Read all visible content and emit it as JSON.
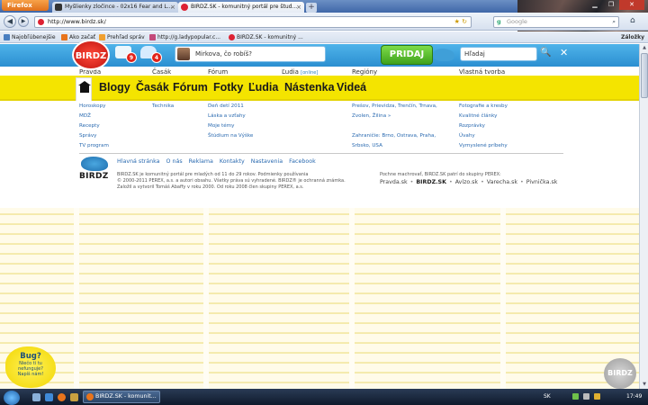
{
  "browser": {
    "app_button": "Firefox",
    "tabs": [
      {
        "label": "Myšlienky zločince - 02x16 Fear and L..."
      },
      {
        "label": "BIRDZ.SK - komunitný portál pre štud..."
      }
    ],
    "new_tab": "+",
    "url": "http://www.birdz.sk/",
    "search_placeholder": "Google",
    "bookmarks": [
      {
        "label": "Najobľúbenejšie"
      },
      {
        "label": "Ako začať"
      },
      {
        "label": "Prehľad správ"
      },
      {
        "label": "http://g.ladypopular.c..."
      },
      {
        "label": "BIRDZ.SK - komunitný ..."
      }
    ],
    "bookmarks_more": "Záložky"
  },
  "site": {
    "logo": "BIRDZ",
    "badges": {
      "messages": "9",
      "friends": "4"
    },
    "status_placeholder": "Mirkova, čo robíš?",
    "pridaj": "PRIDAJ",
    "search_placeholder": "Hľadaj",
    "sub_labels": [
      {
        "label": "Pravda"
      },
      {
        "label": "Časák"
      },
      {
        "label": "Fórum"
      },
      {
        "label": "Ľudia",
        "extra": "[online]"
      },
      {
        "label": "Regióny"
      },
      {
        "label": "Vlastná tvorba"
      }
    ],
    "nav": [
      "Blogy",
      "Časák",
      "Fórum",
      "Fotky",
      "Ľudia",
      "Nástenka",
      "Videá"
    ],
    "columns": {
      "col1": [
        "Horoskopy",
        "MDŽ",
        "Recepty",
        "Správy",
        "TV program"
      ],
      "col2": [
        "Technika"
      ],
      "col3": [
        "Deň detí 2011",
        "Láska a vzťahy",
        "Moje témy",
        "Štúdium na Výške"
      ],
      "col4": [
        "Prešov, Prievidza, Trenčín, Trnava,",
        "Zvolen, Žilina »",
        "",
        "Zahraničie: Brno, Ostrava, Praha,",
        "Srbsko, USA"
      ],
      "col5": [
        "Fotografie a kresby",
        "Kvalitné články",
        "Rozprávky",
        "Úvahy",
        "Vymyslené príbehy"
      ]
    },
    "footer": {
      "logo": "BIRDZ",
      "links": [
        "Hlavná stránka",
        "O nás",
        "Reklama",
        "Kontakty",
        "Nastavenia",
        "Facebook"
      ],
      "text1": "BIRDZ.SK je komunitný portál pre mladých od 11 do 29 rokov. Podmienky používania",
      "text2": "© 2000-2011 PEREX, a.s. a autori obsahu. Všetky práva sú vyhradené. BIRDZ® je ochranná známka.",
      "text3": "Založil a vytvoril Tomáš Abaffy v roku 2000. Od roku 2008 člen skupiny PEREX, a.s.",
      "perex": "Pochne machrovať, BIRDZ.SK patrí do skupiny PEREX:",
      "brands": [
        "Pravda.sk",
        "BIRDZ.SK",
        "Avízo.sk",
        "Varecha.sk",
        "Pivnička.sk"
      ]
    },
    "bug": {
      "title": "Bug?",
      "line1": "Niečo ti tu",
      "line2": "nefunguje?",
      "line3": "Napíš nám!"
    },
    "corner_logo": "BIRDZ"
  },
  "taskbar": {
    "task": "BIRDZ.SK - komunit...",
    "lang": "SK",
    "time": "17:49"
  }
}
